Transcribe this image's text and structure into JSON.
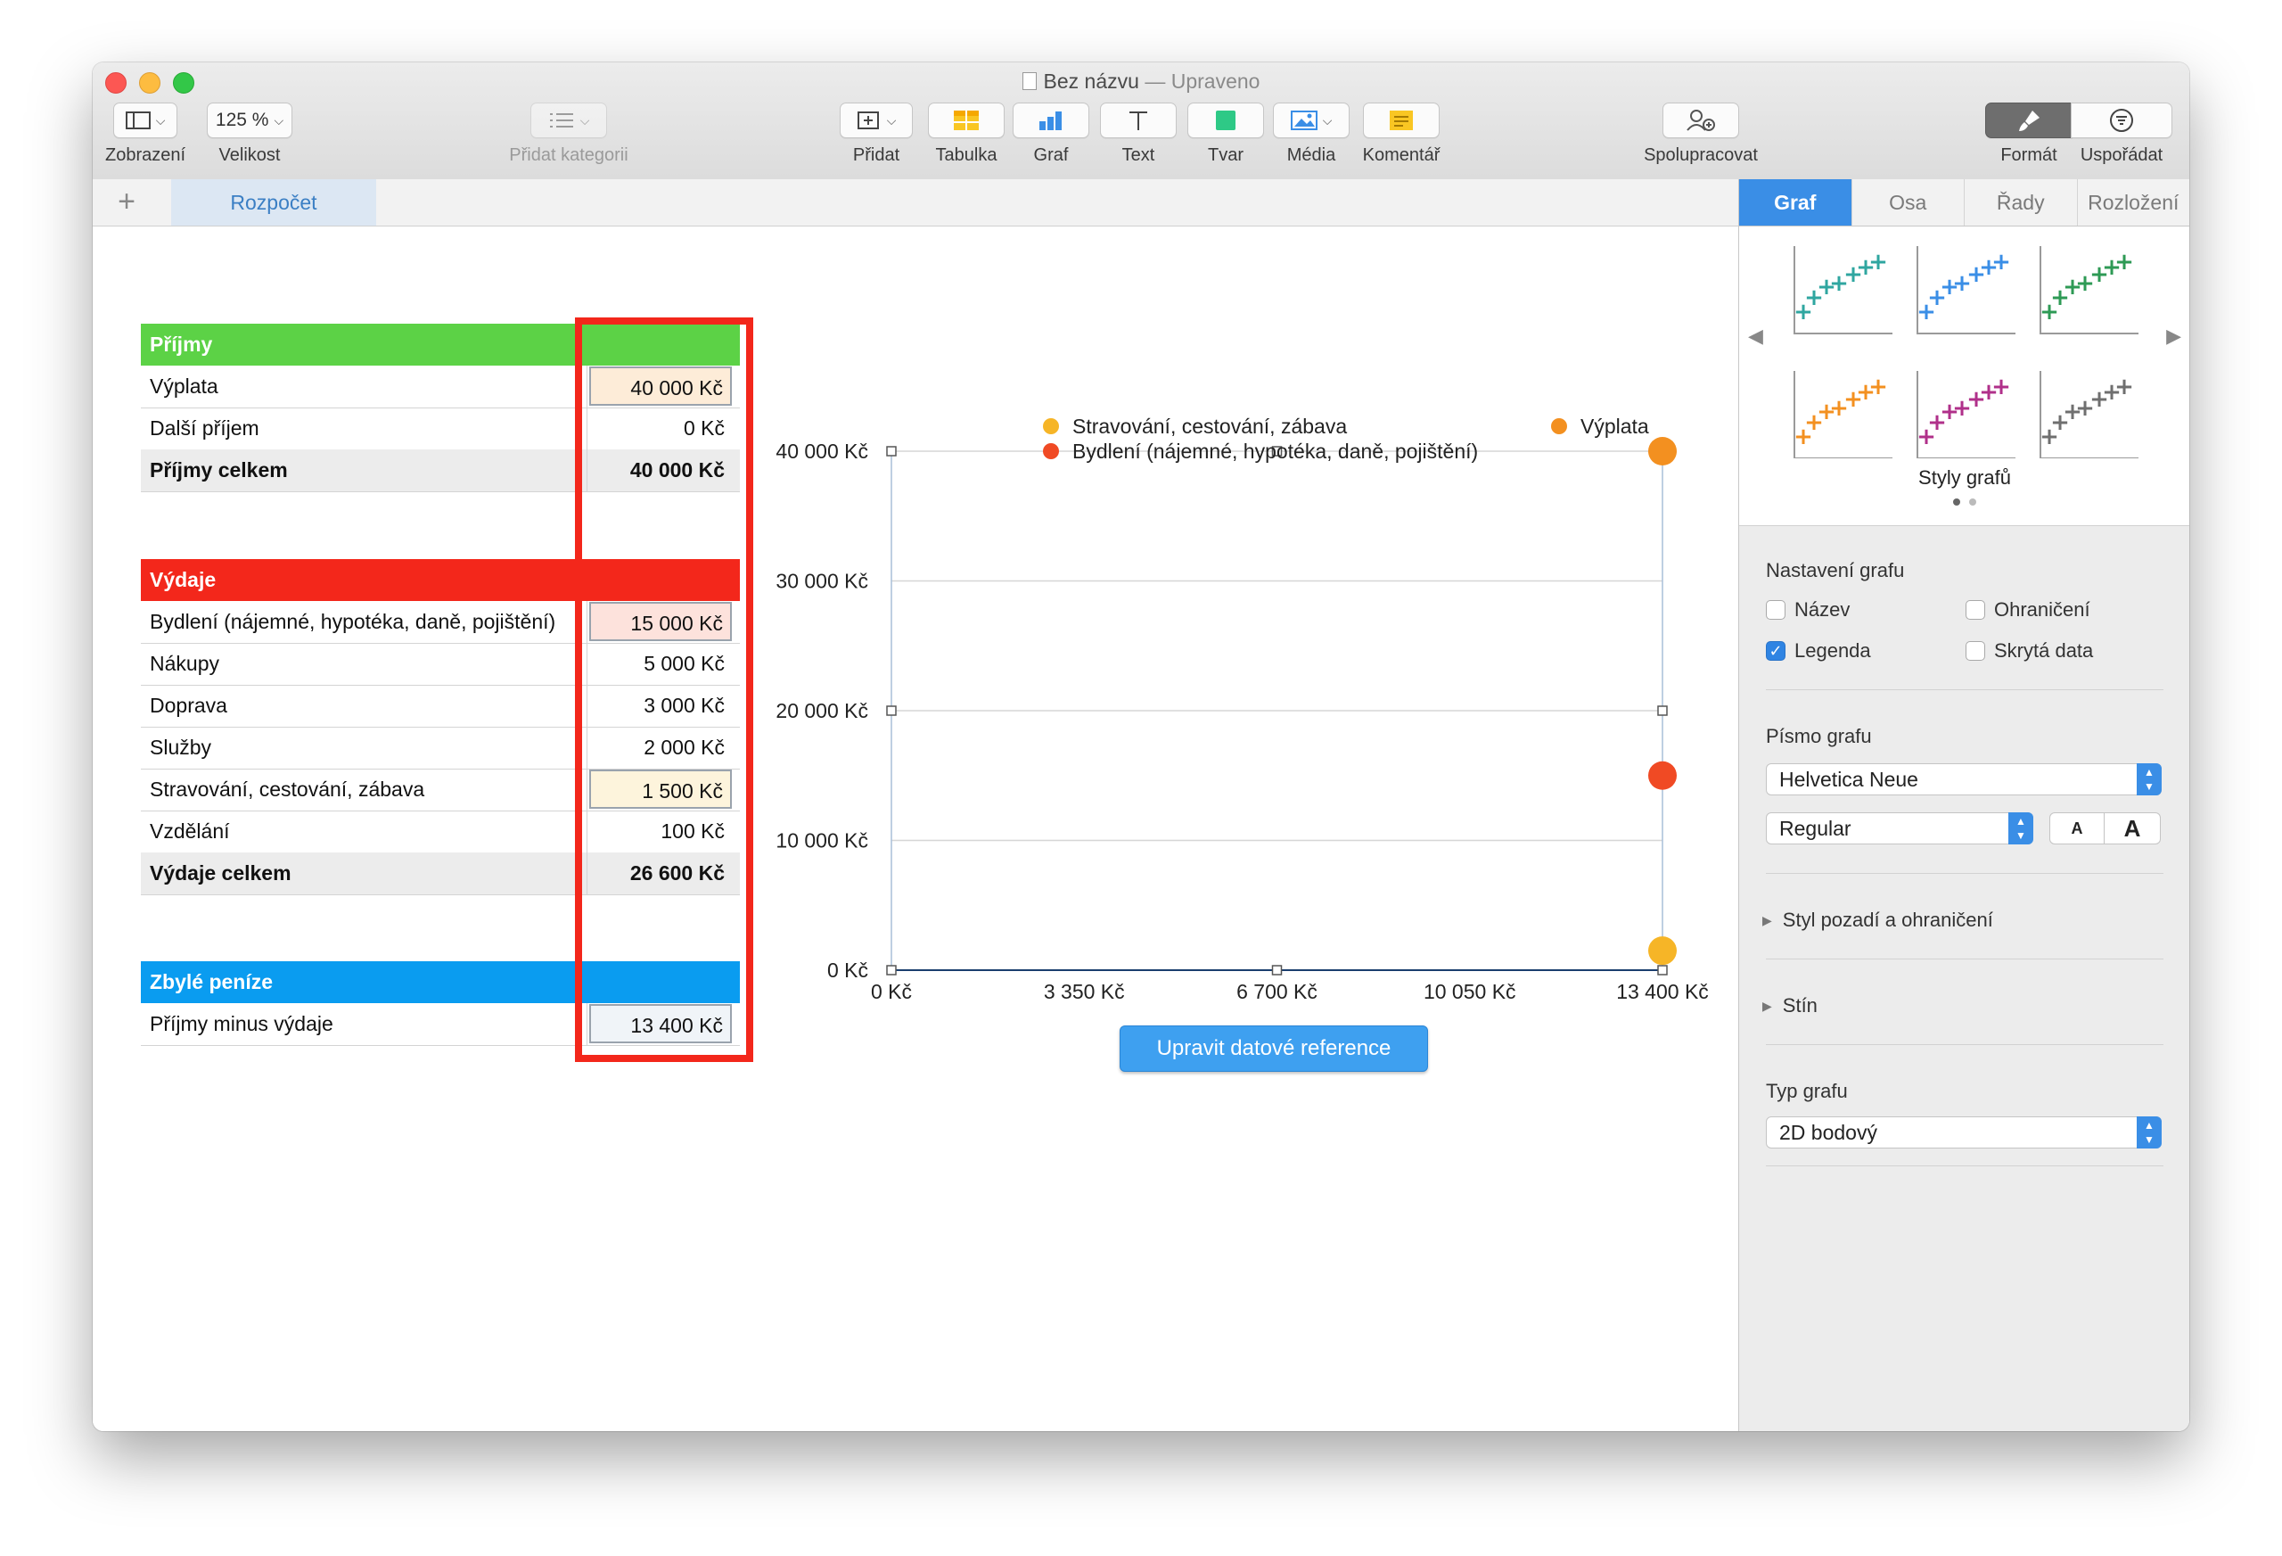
{
  "window": {
    "title": "Bez názvu",
    "title_separator": "—",
    "status": "Upraveno"
  },
  "toolbar": {
    "view_label": "Zobrazení",
    "zoom_value": "125 %",
    "zoom_label": "Velikost",
    "add_category_label": "Přidat kategorii",
    "insert_label": "Přidat",
    "table_label": "Tabulka",
    "chart_label": "Graf",
    "text_label": "Text",
    "shape_label": "Tvar",
    "media_label": "Média",
    "comment_label": "Komentář",
    "collaborate_label": "Spolupracovat",
    "format_label": "Formát",
    "organize_label": "Uspořádat"
  },
  "sheets": {
    "add": "+",
    "active_tab": "Rozpočet"
  },
  "tables": {
    "income": {
      "header": "Příjmy",
      "header_color": "#5cd246",
      "rows": [
        {
          "label": "Výplata",
          "value": "40 000 Kč"
        },
        {
          "label": "Další příjem",
          "value": "0 Kč"
        }
      ],
      "total": {
        "label": "Příjmy celkem",
        "value": "40 000 Kč"
      }
    },
    "expenses": {
      "header": "Výdaje",
      "header_color": "#f3271b",
      "rows": [
        {
          "label": "Bydlení (nájemné, hypotéka, daně, pojištění)",
          "value": "15 000 Kč"
        },
        {
          "label": "Nákupy",
          "value": "5 000 Kč"
        },
        {
          "label": "Doprava",
          "value": "3 000 Kč"
        },
        {
          "label": "Služby",
          "value": "2 000 Kč"
        },
        {
          "label": "Stravování, cestování, zábava",
          "value": "1 500 Kč"
        },
        {
          "label": "Vzdělání",
          "value": "100 Kč"
        }
      ],
      "total": {
        "label": "Výdaje celkem",
        "value": "26 600 Kč"
      }
    },
    "remaining": {
      "header": "Zbylé peníze",
      "header_color": "#0a9cf0",
      "rows": [
        {
          "label": "Příjmy minus výdaje",
          "value": "13 400 Kč"
        }
      ]
    }
  },
  "chart_data": {
    "type": "scatter",
    "legend_position": "top",
    "grid": true,
    "x_ticks": [
      "0 Kč",
      "3 350 Kč",
      "6 700 Kč",
      "10 050 Kč",
      "13 400 Kč"
    ],
    "y_ticks": [
      "0 Kč",
      "10 000 Kč",
      "20 000 Kč",
      "30 000 Kč",
      "40 000 Kč"
    ],
    "xlim": [
      0,
      13400
    ],
    "ylim": [
      0,
      40000
    ],
    "series": [
      {
        "name": "Stravování, cestování, zábava",
        "color": "#f6b527",
        "points": [
          {
            "x": 13400,
            "y": 1500
          }
        ]
      },
      {
        "name": "Výplata",
        "color": "#f39020",
        "points": [
          {
            "x": 13400,
            "y": 40000
          }
        ]
      },
      {
        "name": "Bydlení (nájemné, hypotéka, daně, pojištění)",
        "color": "#f04a24",
        "points": [
          {
            "x": 13400,
            "y": 15000
          }
        ]
      }
    ]
  },
  "chart_button": "Upravit datové reference",
  "inspector": {
    "tabs": [
      "Graf",
      "Osa",
      "Řady",
      "Rozložení"
    ],
    "active_tab": "Graf",
    "styles_caption": "Styly grafů",
    "style_colors": [
      "#2fa6a0",
      "#3a8ee6",
      "#2e9a55",
      "#f39020",
      "#b0308a",
      "#6f6f6f"
    ],
    "settings_title": "Nastavení grafu",
    "options": {
      "title": {
        "label": "Název",
        "checked": false
      },
      "border": {
        "label": "Ohraničení",
        "checked": false
      },
      "legend": {
        "label": "Legenda",
        "checked": true
      },
      "hidden_data": {
        "label": "Skrytá data",
        "checked": false
      }
    },
    "font_title": "Písmo grafu",
    "font_family": "Helvetica Neue",
    "font_style": "Regular",
    "font_smaller": "A",
    "font_larger": "A",
    "background_section": "Styl pozadí a ohraničení",
    "shadow_section": "Stín",
    "chart_type_title": "Typ grafu",
    "chart_type": "2D bodový"
  }
}
